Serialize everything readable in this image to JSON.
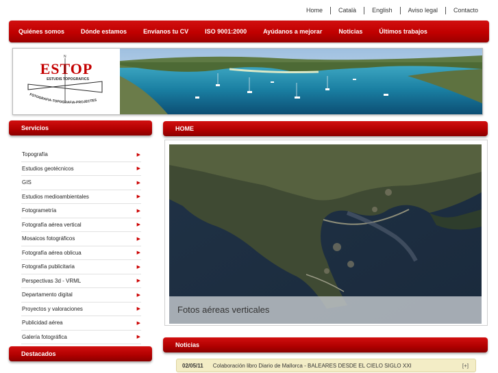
{
  "top_links": [
    "Home",
    "Català",
    "English",
    "Aviso legal",
    "Contacto"
  ],
  "main_nav": [
    "Quiénes somos",
    "Dónde estamos",
    "Envíanos tu CV",
    "ISO 9001:2000",
    "Ayúdanos a mejorar",
    "Noticias",
    "Últimos trabajos"
  ],
  "logo": {
    "name": "ESTOP",
    "subtitle": "ESTUDIS TOPOGRAFICS",
    "tagline": "FOTOGRAFIA-TOPOGRAFIA-PROJECTES"
  },
  "services": {
    "title": "Servicios",
    "items": [
      "Topografía",
      "Estudios geotécnicos",
      "GIS",
      "Estudios medioambientales",
      "Fotogrametría",
      "Fotografía aérea vertical",
      "Mosaicos fotográficos",
      "Fotografía aérea oblicua",
      "Fotografía publicitaria",
      "Perspectivas 3d - VRML",
      "Departamento digital",
      "Proyectos y valoraciones",
      "Publicidad aérea",
      "Galería fotográfica"
    ]
  },
  "featured": {
    "title": "Destacados"
  },
  "home": {
    "title": "HOME",
    "caption": "Fotos aéreas verticales"
  },
  "news": {
    "title": "Noticias",
    "items": [
      {
        "date": "02/05/11",
        "title": "Colaboración libro Diario de Mallorca - BALEARES DESDE EL CIELO SIGLO XXI",
        "more": "[+]"
      }
    ]
  },
  "icons": {
    "service_arrow": "arrow-right-icon"
  },
  "colors": {
    "accent": "#c00000",
    "news_bg": "#f3edc6",
    "arrow": "#cc0000"
  }
}
